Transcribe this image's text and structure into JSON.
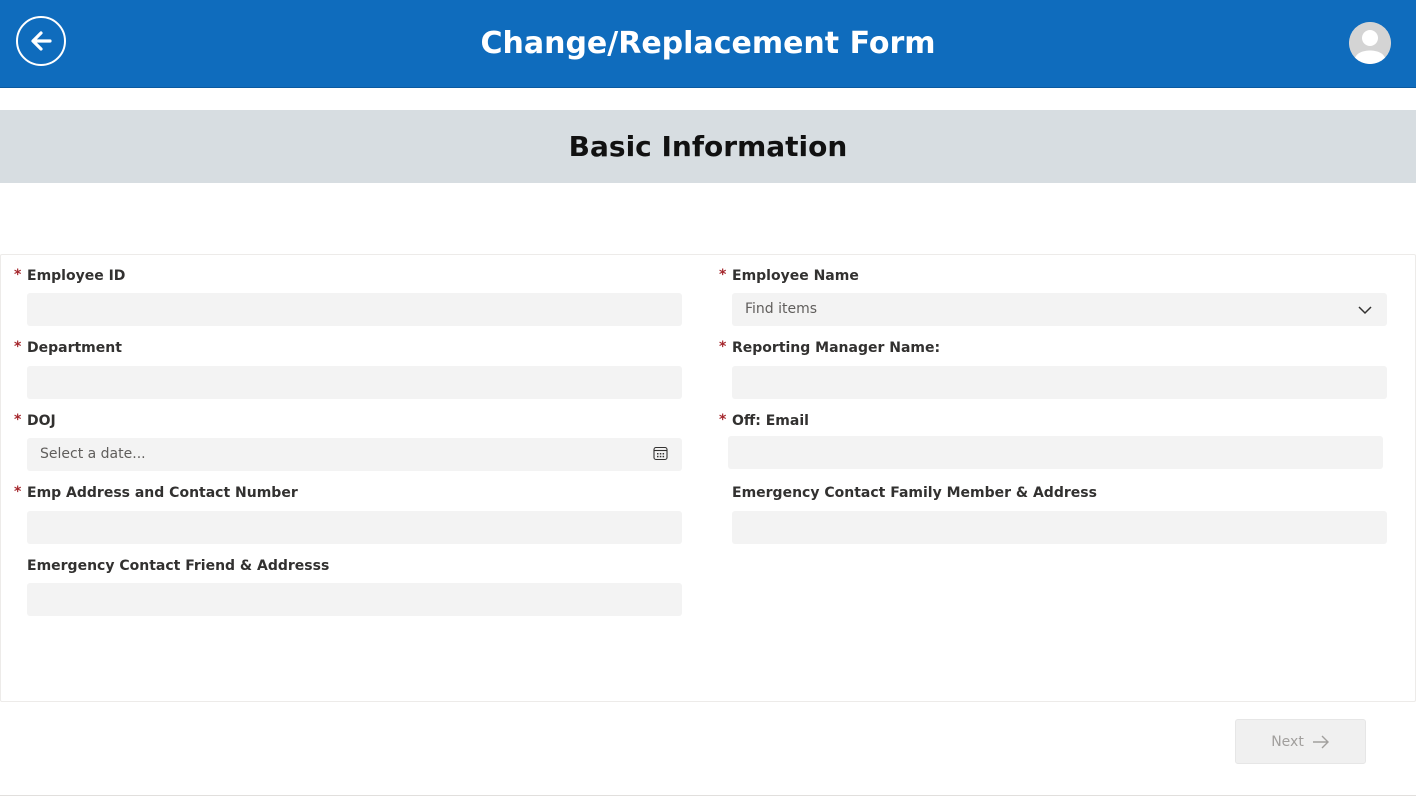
{
  "header": {
    "title": "Change/Replacement Form",
    "accent_color": "#0f6cbd",
    "back_icon": "arrow-left-icon",
    "avatar_icon": "user-avatar-icon"
  },
  "section": {
    "title": "Basic Information"
  },
  "fields": {
    "employee_id": {
      "label": "Employee ID",
      "required": "*",
      "value": ""
    },
    "employee_name": {
      "label": "Employee Name",
      "required": "*",
      "placeholder": "Find items",
      "icon": "chevron-down-icon"
    },
    "department": {
      "label": "Department",
      "required": "*",
      "value": ""
    },
    "reporting_manager": {
      "label": "Reporting Manager Name:",
      "required": "*",
      "value": ""
    },
    "doj": {
      "label": "DOJ",
      "required": "*",
      "placeholder": "Select a date...",
      "icon": "calendar-icon"
    },
    "off_email": {
      "label": "Off: Email",
      "required": "*",
      "value": ""
    },
    "emp_address": {
      "label": "Emp Address and Contact Number",
      "required": "*",
      "value": ""
    },
    "emergency_family": {
      "label": "Emergency Contact Family Member & Address",
      "value": ""
    },
    "emergency_friend": {
      "label": "Emergency Contact Friend & Addresss",
      "value": ""
    }
  },
  "actions": {
    "next_label": "Next",
    "next_icon": "arrow-right-icon"
  }
}
